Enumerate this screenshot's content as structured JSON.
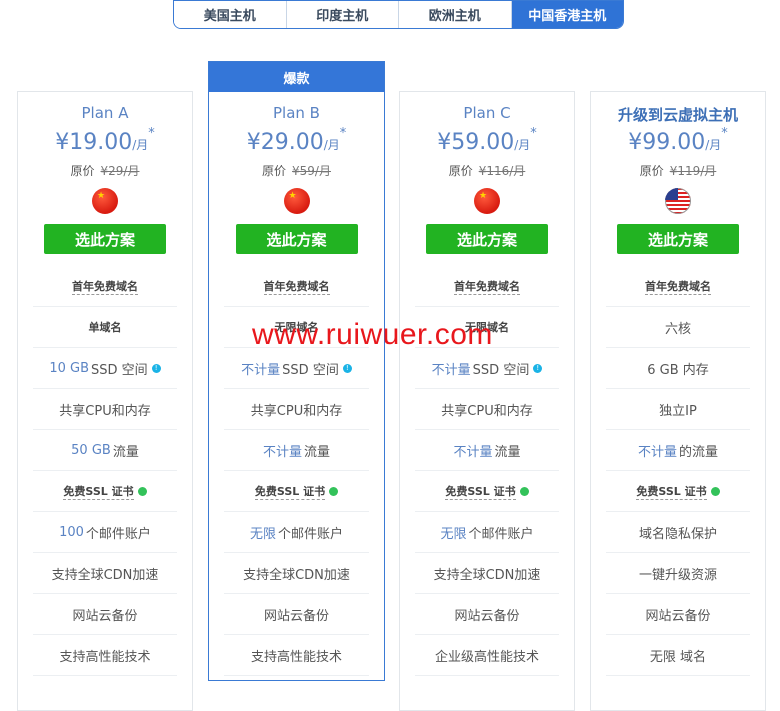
{
  "tabs": [
    {
      "label": "美国主机",
      "active": false
    },
    {
      "label": "印度主机",
      "active": false
    },
    {
      "label": "欧洲主机",
      "active": false
    },
    {
      "label": "中国香港主机",
      "active": true
    }
  ],
  "watermark": "www.ruiwuer.com",
  "plans": [
    {
      "name": "Plan A",
      "price": "¥19.00",
      "unit": "/月",
      "star": "*",
      "orig_label": "原价",
      "orig_price": "¥29/月",
      "flag": "china-flag-icon",
      "button": "选此方案",
      "features": [
        {
          "hl": "",
          "text": "首年免费域名"
        },
        {
          "hl": "",
          "text": "单域名"
        },
        {
          "hl": "10 GB",
          "text": "SSD 空间"
        },
        {
          "hl": "",
          "text": "共享CPU和内存"
        },
        {
          "hl": "50 GB",
          "text": "流量"
        },
        {
          "hl": "",
          "text": "免费SSL 证书"
        },
        {
          "hl": "100",
          "text": "个邮件账户"
        },
        {
          "hl": "",
          "text": "支持全球CDN加速"
        },
        {
          "hl": "",
          "text": "网站云备份"
        },
        {
          "hl": "",
          "text": "支持高性能技术"
        }
      ]
    },
    {
      "ribbon": "爆款",
      "name": "Plan B",
      "price": "¥29.00",
      "unit": "/月",
      "star": "*",
      "orig_label": "原价",
      "orig_price": "¥59/月",
      "flag": "china-flag-icon",
      "button": "选此方案",
      "features": [
        {
          "hl": "",
          "text": "首年免费域名"
        },
        {
          "hl": "",
          "text": "无限域名"
        },
        {
          "hl": "不计量",
          "text": "SSD 空间"
        },
        {
          "hl": "",
          "text": "共享CPU和内存"
        },
        {
          "hl": "不计量",
          "text": "流量"
        },
        {
          "hl": "",
          "text": "免费SSL 证书"
        },
        {
          "hl": "无限",
          "text": "个邮件账户"
        },
        {
          "hl": "",
          "text": "支持全球CDN加速"
        },
        {
          "hl": "",
          "text": "网站云备份"
        },
        {
          "hl": "",
          "text": "支持高性能技术"
        }
      ]
    },
    {
      "name": "Plan C",
      "price": "¥59.00",
      "unit": "/月",
      "star": "*",
      "orig_label": "原价",
      "orig_price": "¥116/月",
      "flag": "china-flag-icon",
      "button": "选此方案",
      "features": [
        {
          "hl": "",
          "text": "首年免费域名"
        },
        {
          "hl": "",
          "text": "无限域名"
        },
        {
          "hl": "不计量",
          "text": "SSD 空间"
        },
        {
          "hl": "",
          "text": "共享CPU和内存"
        },
        {
          "hl": "不计量",
          "text": "流量"
        },
        {
          "hl": "",
          "text": "免费SSL 证书"
        },
        {
          "hl": "无限",
          "text": "个邮件账户"
        },
        {
          "hl": "",
          "text": "支持全球CDN加速"
        },
        {
          "hl": "",
          "text": "网站云备份"
        },
        {
          "hl": "",
          "text": "企业级高性能技术"
        }
      ]
    },
    {
      "name": "升级到云虚拟主机",
      "price": "¥99.00",
      "unit": "/月",
      "star": "*",
      "orig_label": "原价",
      "orig_price": "¥119/月",
      "flag": "usa-flag-icon",
      "button": "选此方案",
      "features": [
        {
          "hl": "",
          "text": "首年免费域名"
        },
        {
          "hl": "",
          "text": "六核"
        },
        {
          "hl": "",
          "text": "6 GB 内存"
        },
        {
          "hl": "",
          "text": "独立IP"
        },
        {
          "hl": "不计量",
          "text": "的流量"
        },
        {
          "hl": "",
          "text": "免费SSL 证书"
        },
        {
          "hl": "",
          "text": "域名隐私保护"
        },
        {
          "hl": "",
          "text": "一键升级资源"
        },
        {
          "hl": "",
          "text": "网站云备份"
        },
        {
          "hl": "",
          "text": "无限 域名"
        }
      ]
    }
  ]
}
